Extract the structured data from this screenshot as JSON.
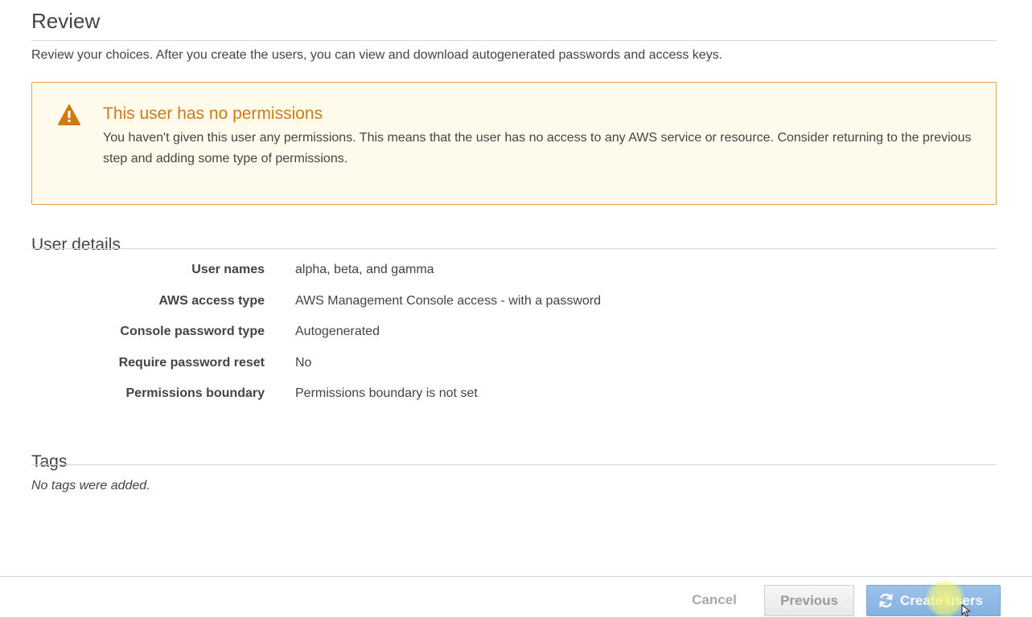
{
  "review": {
    "title": "Review",
    "description": "Review your choices. After you create the users, you can view and download autogenerated passwords and access keys."
  },
  "warning": {
    "icon": "warning-triangle-icon",
    "title": "This user has no permissions",
    "body": "You haven't given this user any permissions. This means that the user has no access to any AWS service or resource. Consider returning to the previous step and adding some type of permissions.",
    "title_color": "#d07a12",
    "border_color": "#e0a34a",
    "background": "#fffbec"
  },
  "user_details": {
    "title": "User details",
    "rows": [
      {
        "label": "User names",
        "value": "alpha, beta, and gamma"
      },
      {
        "label": "AWS access type",
        "value": "AWS Management Console access - with a password"
      },
      {
        "label": "Console password type",
        "value": "Autogenerated"
      },
      {
        "label": "Require password reset",
        "value": "No"
      },
      {
        "label": "Permissions boundary",
        "value": "Permissions boundary is not set"
      }
    ]
  },
  "tags": {
    "title": "Tags",
    "empty_text": "No tags were added."
  },
  "footer": {
    "cancel_label": "Cancel",
    "previous_label": "Previous",
    "create_label": "Create users",
    "create_icon": "refresh-spinner-icon",
    "primary_color": "#86b1e0"
  }
}
